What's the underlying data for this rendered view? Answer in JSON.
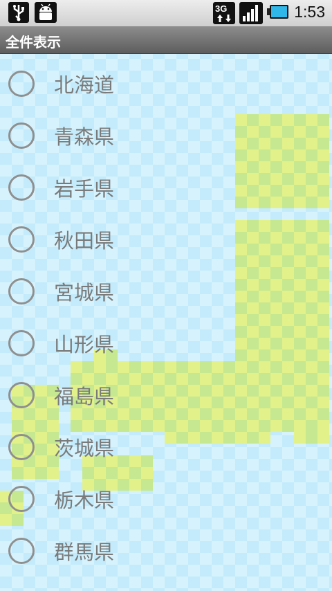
{
  "status_bar": {
    "network_label": "3G",
    "time": "1:53",
    "icons": [
      "usb-icon",
      "android-debug-icon",
      "network-3g-icon",
      "signal-icon",
      "battery-icon"
    ]
  },
  "title_bar": {
    "title": "全件表示"
  },
  "prefectures": [
    {
      "label": "北海道"
    },
    {
      "label": "青森県"
    },
    {
      "label": "岩手県"
    },
    {
      "label": "秋田県"
    },
    {
      "label": "宮城県"
    },
    {
      "label": "山形県"
    },
    {
      "label": "福島県"
    },
    {
      "label": "茨城県"
    },
    {
      "label": "栃木県"
    },
    {
      "label": "群馬県"
    }
  ],
  "colors": {
    "background_light": "#d6f3fd",
    "background_check": "#c3ebfb",
    "map_yellow": "#e3f18a",
    "map_green": "#c5e890"
  }
}
